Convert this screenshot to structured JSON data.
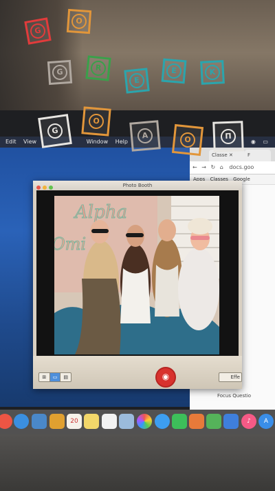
{
  "overlay_letters": {
    "row1": [
      "G",
      "O"
    ],
    "row2": [
      "G",
      "R",
      "E",
      "E",
      "K"
    ],
    "row3": [
      "G",
      "O",
      "A",
      "O",
      "Π"
    ]
  },
  "menubar": {
    "items": [
      "Edit",
      "View",
      "Window",
      "Help"
    ]
  },
  "photo_booth": {
    "window_title": "Photo Booth",
    "effects_label": "Effe",
    "photo_banner_line1": "Alpha",
    "photo_banner_line2": "Omi"
  },
  "browser": {
    "tab1_label": "Classe",
    "tab2_label": "F",
    "address": "docs.goo",
    "bookmarks": [
      "Apps",
      "Classes",
      "Google"
    ],
    "footer_text": "Focus Questio"
  },
  "dock": {
    "calendar_day": "20"
  },
  "colors": {
    "tile_red": "#e23b3b",
    "tile_orange": "#e2963a",
    "tile_gray": "#b0a8a0",
    "tile_green": "#3aa04a",
    "tile_teal": "#2aa5ad",
    "tile_white": "#e8e6e2"
  }
}
